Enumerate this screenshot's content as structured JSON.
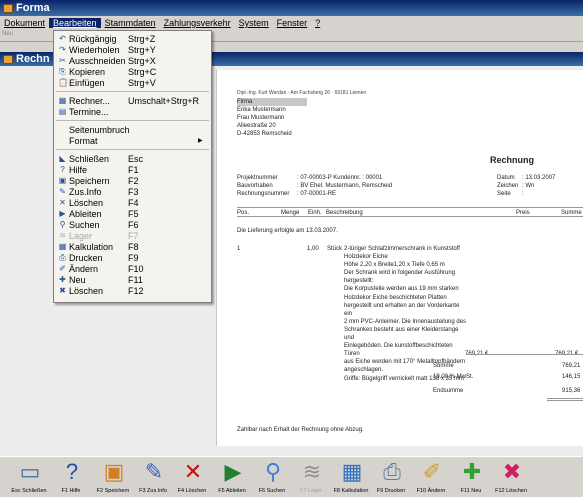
{
  "window": {
    "title": "Forma",
    "inner_title": "Rechn"
  },
  "menubar": [
    "Dokument",
    "Bearbeiten",
    "Stammdaten",
    "Zahlungsverkehr",
    "System",
    "Fenster",
    "?"
  ],
  "toolbar_strip": {
    "label": "Neu"
  },
  "edit_menu": {
    "groups": [
      [
        {
          "icon": "undo-icon",
          "glyph": "↶",
          "label": "Rückgängig",
          "shortcut": "Strg+Z"
        },
        {
          "icon": "redo-icon",
          "glyph": "↷",
          "label": "Wiederholen",
          "shortcut": "Strg+Y"
        },
        {
          "icon": "cut-icon",
          "glyph": "✂",
          "label": "Ausschneiden",
          "shortcut": "Strg+X"
        },
        {
          "icon": "copy-icon",
          "glyph": "⎘",
          "label": "Kopieren",
          "shortcut": "Strg+C"
        },
        {
          "icon": "paste-icon",
          "glyph": "📋",
          "label": "Einfügen",
          "shortcut": "Strg+V"
        }
      ],
      [
        {
          "icon": "calculator-icon",
          "glyph": "▦",
          "label": "Rechner...",
          "shortcut": "Umschalt+Strg+R"
        },
        {
          "icon": "calendar-icon",
          "glyph": "▤",
          "label": "Termine...",
          "shortcut": ""
        }
      ],
      [
        {
          "icon": "",
          "glyph": "",
          "label": "Seitenumbruch",
          "shortcut": ""
        },
        {
          "icon": "",
          "glyph": "",
          "label": "Format",
          "shortcut": "",
          "submenu": true
        }
      ],
      [
        {
          "icon": "close-doc-icon",
          "glyph": "◣",
          "label": "Schließen",
          "shortcut": "Esc"
        },
        {
          "icon": "help-icon",
          "glyph": "?",
          "label": "Hilfe",
          "shortcut": "F1"
        },
        {
          "icon": "save-icon",
          "glyph": "▣",
          "label": "Speichern",
          "shortcut": "F2"
        },
        {
          "icon": "info-icon",
          "glyph": "✎",
          "label": "Zus.Info",
          "shortcut": "F3"
        },
        {
          "icon": "delete-icon",
          "glyph": "✕",
          "label": "Löschen",
          "shortcut": "F4"
        },
        {
          "icon": "file-icon",
          "glyph": "▶",
          "label": "Ableiten",
          "shortcut": "F5"
        },
        {
          "icon": "search-icon",
          "glyph": "⚲",
          "label": "Suchen",
          "shortcut": "F6"
        },
        {
          "icon": "stock-icon",
          "glyph": "≋",
          "label": "Lager",
          "shortcut": "F7",
          "disabled": true
        },
        {
          "icon": "calculation-icon",
          "glyph": "▦",
          "label": "Kalkulation",
          "shortcut": "F8"
        },
        {
          "icon": "print-icon",
          "glyph": "⎙",
          "label": "Drucken",
          "shortcut": "F9"
        },
        {
          "icon": "edit-icon",
          "glyph": "✐",
          "label": "Ändern",
          "shortcut": "F10"
        },
        {
          "icon": "new-icon",
          "glyph": "✚",
          "label": "Neu",
          "shortcut": "F11"
        },
        {
          "icon": "delete-icon",
          "glyph": "✖",
          "label": "Löschen",
          "shortcut": "F12"
        }
      ]
    ]
  },
  "document": {
    "sender": "Dipl.-Ing. Kurt Werdan · Am Fuchsberg 26 · 69181 Leimen",
    "address": [
      "Firma",
      "Erika Mustermann",
      "Frau Mustermann",
      "Alleestraße 20",
      "D-42853 Remscheid"
    ],
    "heading": "Rechnung",
    "meta_left": [
      {
        "k": "Projektnummer",
        "v": ": 07-00003-P          Kundennr. : 00001"
      },
      {
        "k": "Bauvorhaben",
        "v": ": BV Ehel. Mustermann, Remscheid"
      },
      {
        "k": "Rechnungsnummer",
        "v": ": 07-00001-RE"
      }
    ],
    "meta_right": [
      {
        "k": "Datum",
        "v": ": 13.03.2007"
      },
      {
        "k": "Zeichen",
        "v": ": Wn"
      },
      {
        "k": "Seite",
        "v": ":"
      }
    ],
    "columns": {
      "pos": "Pos.",
      "qty": "Menge",
      "unit": "Einh.",
      "desc": "Beschreibung",
      "price": "Preis",
      "total": "Summe"
    },
    "delivery": "Die Lieferung erfolgte am 13.03.2007.",
    "item": {
      "pos": "1",
      "qty": "1,00",
      "unit": "Stück",
      "desc": "2-türiger Schlafzimmerschrank in Kunststoff\nHolzdekor Eiche\nHöhe 2,20 x Breite1,20 x Tiefe 0,65 m\nDer Schrank wird in folgender Ausführung\nhergestellt:\nDie Korpusteile werden aus 19 mm starken\nHolzdekor Eiche beschichteten Platten\nhergestellt und erhalten an der Vorderkante ein\n2 mm PVC-Anleimer. Die Innenausteilung des\nSchrankes besteht aus einer Kleiderstange und\nEinlegeböden. Die kunstoffbeschichteten Türen\naus Eiche werden mit 170° Metalltopfbändern\nangeschlagen.\nGriffe: Bügelgriff vernickelt matt 138 x 35 mm",
      "price": "769,21 €",
      "total": "769,21 €"
    },
    "sums": [
      {
        "label": "Summe",
        "value": "769,21"
      },
      {
        "label": "19,00 % MwSt.",
        "value": "146,15"
      },
      {
        "label": "Endsumme",
        "value": "915,36"
      }
    ],
    "footer": "Zahlbar nach Erhalt der Rechnung ohne Abzug."
  },
  "bottom_toolbar": [
    {
      "name": "close",
      "caption": "Esc Schließen",
      "icon": "close-doc-icon",
      "glyph": "▭",
      "color": "#3a6ea5"
    },
    {
      "name": "help",
      "caption": "F1 Hilfe",
      "icon": "help-icon",
      "glyph": "?",
      "color": "#1f4fb0"
    },
    {
      "name": "save",
      "caption": "F2 Speichern",
      "icon": "save-icon",
      "glyph": "▣",
      "color": "#d08020"
    },
    {
      "name": "info",
      "caption": "F3 Zus.Info",
      "icon": "info-icon",
      "glyph": "✎",
      "color": "#4060c0"
    },
    {
      "name": "delete",
      "caption": "F4 Löschen",
      "icon": "delete-icon",
      "glyph": "✕",
      "color": "#d01010"
    },
    {
      "name": "derive",
      "caption": "F5 Ableiten",
      "icon": "file-icon",
      "glyph": "▶",
      "color": "#208030"
    },
    {
      "name": "search",
      "caption": "F6 Suchen",
      "icon": "search-icon",
      "glyph": "⚲",
      "color": "#4080d0"
    },
    {
      "name": "stock",
      "caption": "F7 Lager",
      "icon": "stock-icon",
      "glyph": "≋",
      "color": "#909090",
      "disabled": true
    },
    {
      "name": "calc",
      "caption": "F8 Kalkulation",
      "icon": "calculation-icon",
      "glyph": "▦",
      "color": "#3070c0"
    },
    {
      "name": "print",
      "caption": "F9 Drucken",
      "icon": "print-icon",
      "glyph": "⎙",
      "color": "#6080a0"
    },
    {
      "name": "edit",
      "caption": "F10 Ändern",
      "icon": "edit-icon",
      "glyph": "✐",
      "color": "#d0a020"
    },
    {
      "name": "new",
      "caption": "F11 Neu",
      "icon": "new-icon",
      "glyph": "✚",
      "color": "#30a030"
    },
    {
      "name": "delete2",
      "caption": "F12 Löschen",
      "icon": "delete-icon",
      "glyph": "✖",
      "color": "#d02060"
    }
  ]
}
